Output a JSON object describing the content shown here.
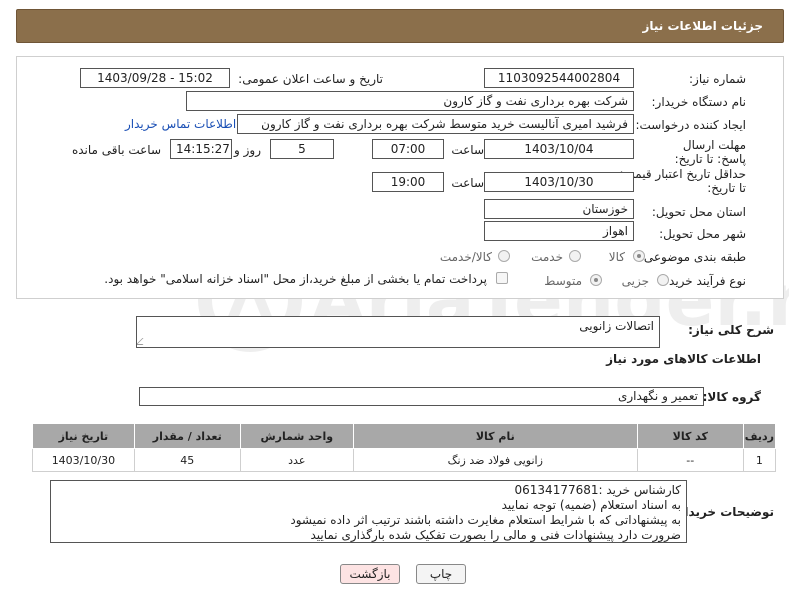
{
  "header": {
    "title": "جزئیات اطلاعات نیاز"
  },
  "form": {
    "need_number_label": "شماره نیاز:",
    "need_number": "1103092544002804",
    "announce_label": "تاریخ و ساعت اعلان عمومی:",
    "announce_value": "1403/09/28 - 15:02",
    "buyer_org_label": "نام دستگاه خریدار:",
    "buyer_org": "شرکت بهره برداری نفت و گاز کارون",
    "creator_label": "ایجاد کننده درخواست:",
    "creator": "فرشید امیری آنالیست خرید متوسط شرکت بهره برداری نفت و گاز کارون",
    "buyer_contact_link": "اطلاعات تماس خریدار",
    "reply_deadline_label": "مهلت ارسال پاسخ: تا تاریخ:",
    "reply_date": "1403/10/04",
    "time_label": "ساعت",
    "reply_time": "07:00",
    "days_value": "5",
    "days_label": "روز و",
    "remaining_time": "14:15:27",
    "remaining_label": "ساعت باقی مانده",
    "price_deadline_label": "حداقل تاریخ اعتبار قیمت: تا تاریخ:",
    "price_date": "1403/10/30",
    "price_time": "19:00",
    "province_label": "استان محل تحویل:",
    "province": "خوزستان",
    "city_label": "شهر محل تحویل:",
    "city": "اهواز",
    "category_label": "طبقه بندی موضوعی:",
    "category_options": [
      "کالا",
      "خدمت",
      "کالا/خدمت"
    ],
    "process_label": "نوع فرآیند خرید :",
    "process_options": [
      "جزیی",
      "متوسط"
    ],
    "payment_note": "پرداخت تمام یا بخشی از مبلغ خرید،از محل \"اسناد خزانه اسلامی\" خواهد بود."
  },
  "summary": {
    "label": "شرح کلی نیاز:",
    "value": "اتصالات زانویی"
  },
  "goods_info": {
    "title": "اطلاعات کالاهای مورد نیاز",
    "group_label": "گروه کالا:",
    "group_value": "تعمیر و نگهداری"
  },
  "table": {
    "headers": [
      "ردیف",
      "کد کالا",
      "نام کالا",
      "واحد شمارش",
      "تعداد / مقدار",
      "تاریخ نیاز"
    ],
    "rows": [
      [
        "1",
        "--",
        "زانویی فولاد ضد زنگ",
        "عدد",
        "45",
        "1403/10/30"
      ]
    ]
  },
  "notes": {
    "label": "توضیحات خریدار:",
    "lines": [
      "کارشناس خرید :06134177681",
      "به اسناد استعلام (ضمیه) توجه نمایید",
      "به پیشنهاداتی که با شرایط استعلام مغایرت داشته باشند ترتیب اثر داده نمیشود",
      "ضرورت دارد پیشنهادات فنی و مالی را بصورت تفکیک شده بارگذاری نمایید"
    ]
  },
  "buttons": {
    "print": "چاپ",
    "back": "بازگشت"
  },
  "watermark": {
    "text": "AriaTender.neT"
  },
  "colors": {
    "header_bg": "#8b6f4b",
    "table_header_bg": "#a8a8a8",
    "link": "#1a4fb5",
    "back_button_bg": "#fde3e3"
  }
}
